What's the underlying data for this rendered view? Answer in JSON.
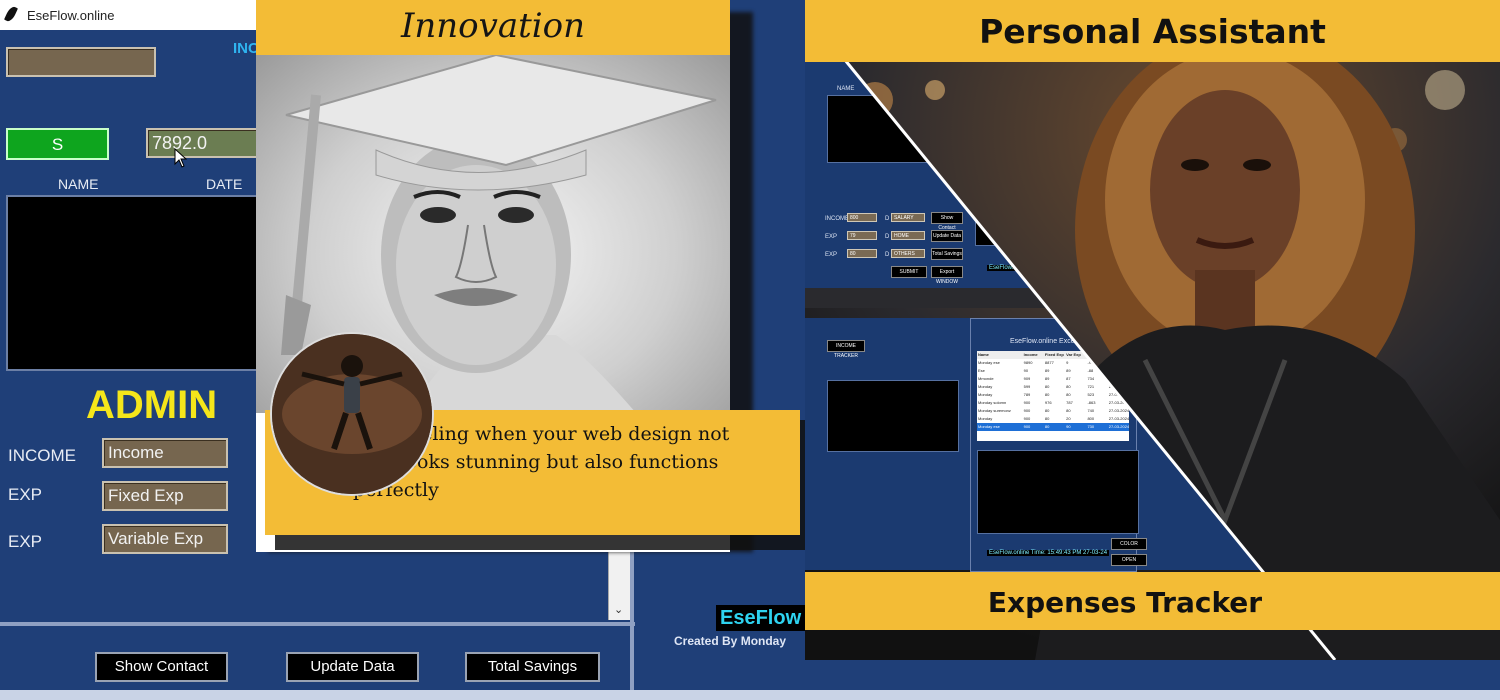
{
  "window": {
    "title": "EseFlow.online"
  },
  "app": {
    "top_right_label": "INC",
    "name_field_value": "",
    "s_button": "S",
    "amount_value": "7892.0",
    "columns": [
      "NAME",
      "DATE"
    ],
    "admin_label": "ADMIN",
    "rows": [
      {
        "label": "INCOME",
        "placeholder": "Income"
      },
      {
        "label": "EXP",
        "placeholder": "Fixed Exp"
      },
      {
        "label": "EXP",
        "placeholder": "Variable Exp"
      }
    ],
    "buttons": [
      "Show Contact",
      "Update Data",
      "Total Savings"
    ],
    "brand": "EseFlow",
    "created_by": "Created By Monday"
  },
  "card_innovation": {
    "title": "Innovation",
    "caption": "That feeling when your web design not only looks stunning but also functions perfectly"
  },
  "card_assistant": {
    "title": "Personal Assistant",
    "footer": "Expenses Tracker",
    "mini_top": {
      "name_col": "NAME",
      "rows": [
        {
          "label": "INCOME",
          "value": "800",
          "letter": "D",
          "cat": "SALARY",
          "btn": "Show Contact"
        },
        {
          "label": "EXP",
          "value": "79",
          "letter": "D",
          "cat": "HOME",
          "btn": "Update Data"
        },
        {
          "label": "EXP",
          "value": "80",
          "letter": "D",
          "cat": "OTHERS",
          "btn": "Total Savings"
        }
      ],
      "submit": "SUBMIT",
      "export": "Export WINDOW",
      "status": "EseFlow.online Time: 15:49:43 PM   27-03"
    },
    "mini_bottom": {
      "header_label": "INCOME TRACKER",
      "excel_title": "EseFlow.online   Excel View",
      "table_headers": [
        "Name",
        "Income",
        "Fixed Exp",
        "Var Exp",
        "Savings",
        "Date"
      ],
      "table_rows": [
        [
          "Monday ese",
          "9890",
          "8877",
          "9",
          "-986",
          "27-03-2024"
        ],
        [
          "Ese",
          "90",
          "89",
          "89",
          "-88",
          "27-03-2024"
        ],
        [
          "Mmonde",
          "909",
          "89",
          "87",
          "734",
          "27-03-2024"
        ],
        [
          "Monday",
          "599",
          "80",
          "80",
          "721",
          "27-03-2024"
        ],
        [
          "Monday",
          "789",
          "80",
          "80",
          "523",
          "27-03-2024"
        ],
        [
          "Monday solomn",
          "900",
          "976",
          "787",
          "-863",
          "27-03-2024"
        ],
        [
          "Monday suremonz",
          "900",
          "80",
          "80",
          "740",
          "27-03-2024"
        ],
        [
          "Monday",
          "900",
          "80",
          "20",
          "800",
          "27-03-2024"
        ],
        [
          "Monday ese",
          "900",
          "80",
          "90",
          "730",
          "27-03-2024"
        ]
      ],
      "color_btn": "COLOR",
      "open_btn": "OPEN",
      "status": "EseFlow.online Time: 15:49:43 PM   27-03-24"
    }
  }
}
